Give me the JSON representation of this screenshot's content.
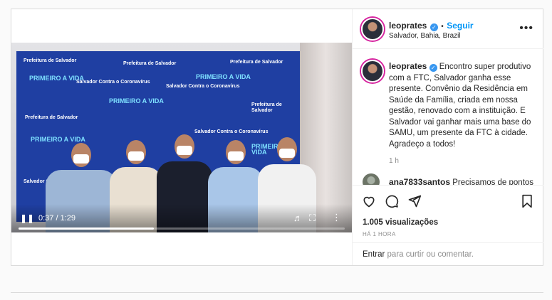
{
  "post": {
    "username": "leoprates",
    "separator": "•",
    "follow_label": "Seguir",
    "location": "Salvador, Bahia, Brazil",
    "more_label": "•••",
    "caption": "Encontro super produtivo com a FTC, Salvador ganha esse presente. Convênio da Residência em Saúde da Família, criada em nossa gestão, renovado com a instituição. E Salvador vai ganhar mais uma base do SAMU, um presente da FTC à cidade. Agradeço a todos!",
    "caption_time": "1 h",
    "comments": [
      {
        "username": "ana7833santos",
        "text": "Precisamos de pontos"
      }
    ],
    "views": "1.005 visualizações",
    "posted": "HÁ 1 HORA",
    "add_comment": {
      "link": "Entrar",
      "rest": " para curtir ou comentar."
    }
  },
  "video": {
    "time": "0:37 / 1:29",
    "progress": 0.415,
    "banner_words": [
      "Prefeitura de Salvador",
      "PRIMEIRO A VIDA",
      "Salvador Contra o Coronavírus"
    ]
  },
  "icons": [
    "like-icon",
    "comment-icon",
    "share-icon",
    "save-icon",
    "play-pause-icon",
    "volume-icon",
    "fullscreen-icon",
    "verified-icon",
    "more-icon"
  ],
  "colors": {
    "accent": "#0095f6",
    "verified": "#3897f0",
    "banner": "#1f3fa2"
  }
}
